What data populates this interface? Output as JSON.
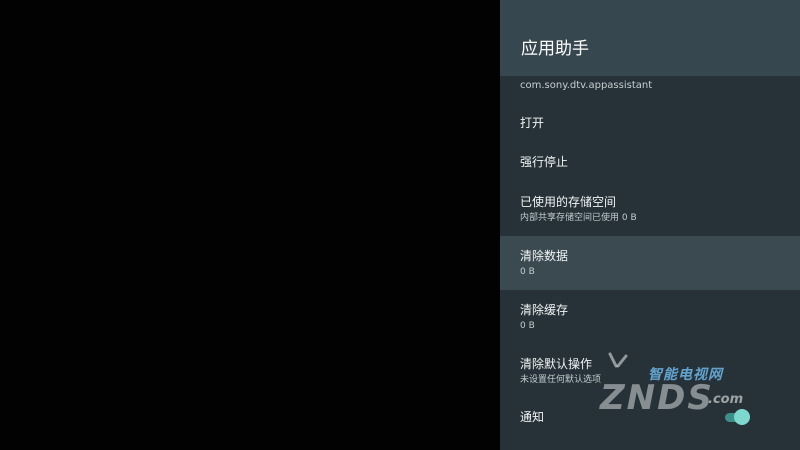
{
  "panel": {
    "title": "应用助手",
    "package": "com.sony.dtv.appassistant"
  },
  "items": [
    {
      "title": "打开",
      "summary": ""
    },
    {
      "title": "强行停止",
      "summary": ""
    },
    {
      "title": "已使用的存储空间",
      "summary": "内部共享存储空间已使用 0 B"
    },
    {
      "title": "清除数据",
      "summary": "0 B"
    },
    {
      "title": "清除缓存",
      "summary": "0 B"
    },
    {
      "title": "清除默认操作",
      "summary": "未设置任何默认选项"
    },
    {
      "title": "通知",
      "summary": "",
      "toggle_on": true
    }
  ],
  "watermark": {
    "cn": "智能电视网",
    "en": "ZNDS",
    "suffix": ".com"
  },
  "colors": {
    "panel_bg": "#263238",
    "header_bg": "#37474f",
    "focus_bg": "#3b4a51",
    "toggle_on": "#7fd8d0"
  }
}
